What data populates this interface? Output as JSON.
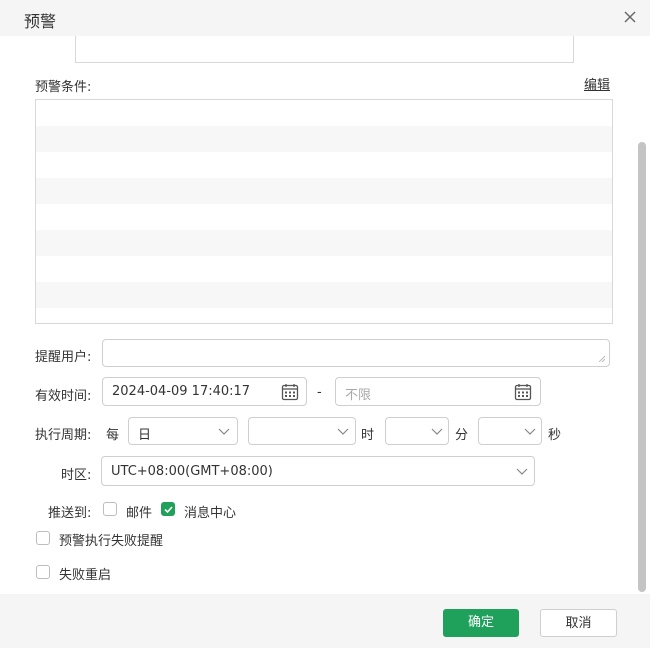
{
  "dialog": {
    "title": "预警",
    "close_icon": "close-icon"
  },
  "conditions": {
    "label": "预警条件:",
    "edit_label": "编辑"
  },
  "fields": {
    "remind_users_label": "提醒用户:",
    "remind_users_value": "",
    "valid_time_label": "有效时间:",
    "valid_start": "2024-04-09 17:40:17",
    "valid_separator": "-",
    "valid_end_placeholder": "不限",
    "cycle_label": "执行周期:",
    "cycle_every": "每",
    "cycle_unit": "日",
    "hour_value": "",
    "hour_label": "时",
    "minute_value": "",
    "minute_label": "分",
    "second_value": "",
    "second_label": "秒",
    "timezone_label": "时区:",
    "timezone_value": "UTC+08:00(GMT+08:00)",
    "push_label": "推送到:",
    "push_mail_label": "邮件",
    "push_mail_checked": false,
    "push_message_label": "消息中心",
    "push_message_checked": true,
    "fail_remind_label": "预警执行失败提醒",
    "fail_remind_checked": false,
    "fail_restart_label": "失败重启",
    "fail_restart_checked": false
  },
  "footer": {
    "confirm_label": "确定",
    "cancel_label": "取消"
  },
  "colors": {
    "accent": "#20a15b",
    "border": "#cfcfcf",
    "header_bg": "#f5f5f5"
  }
}
